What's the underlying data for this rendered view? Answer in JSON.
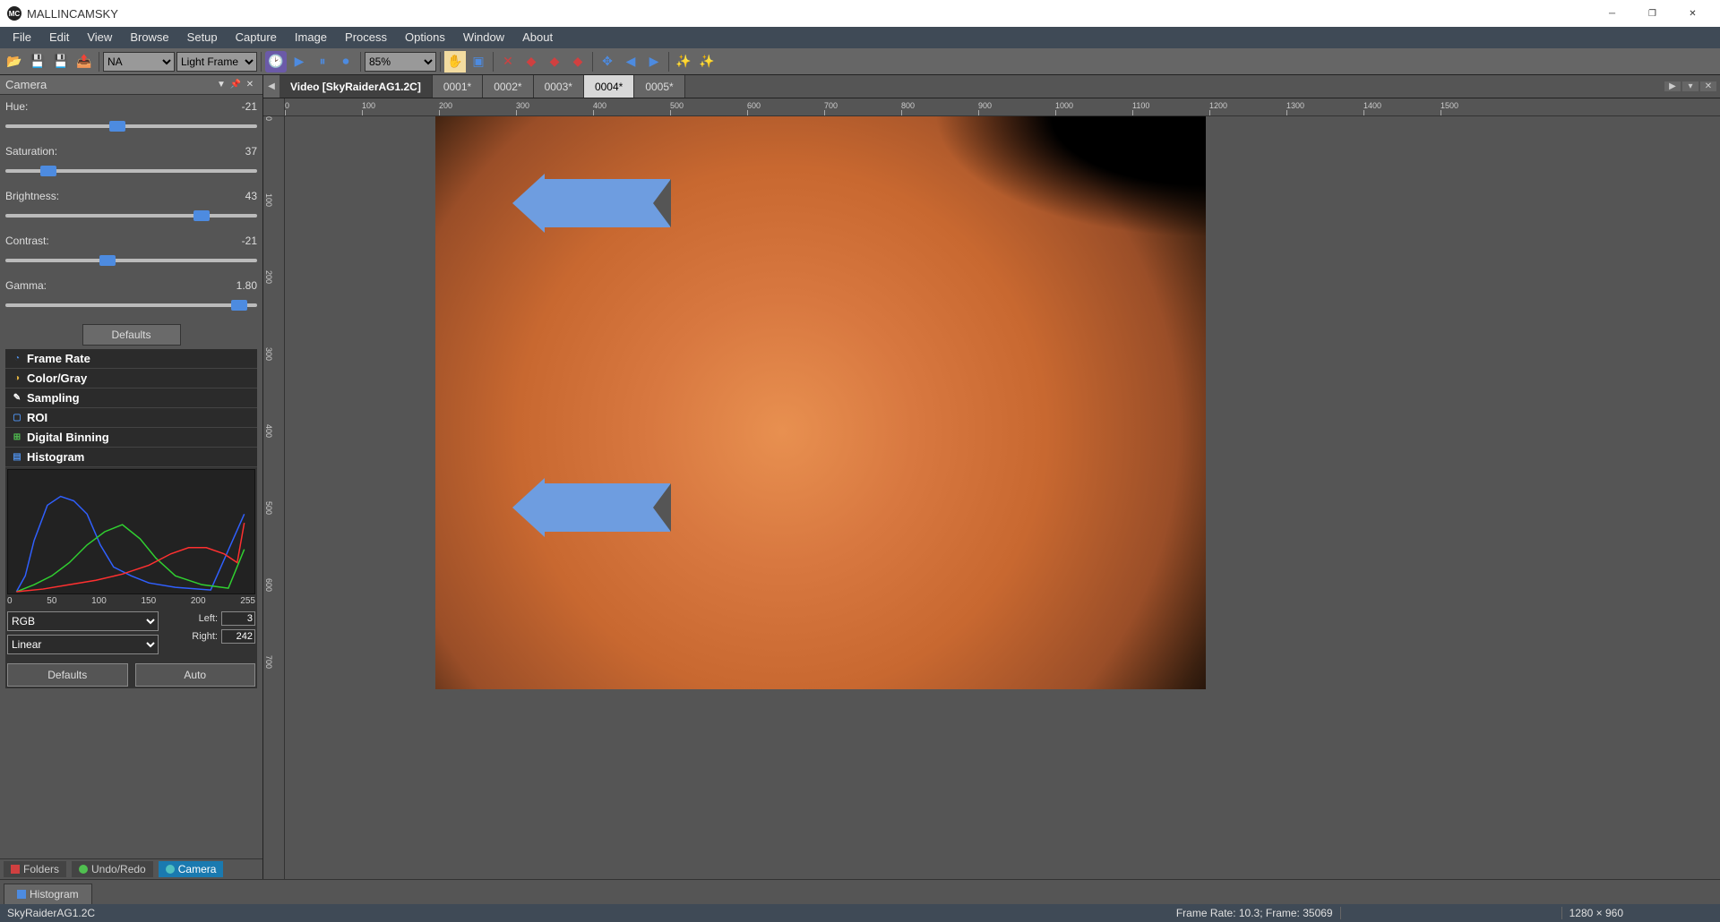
{
  "app": {
    "title": "MALLINCAMSKY"
  },
  "menu": {
    "items": [
      "File",
      "Edit",
      "View",
      "Browse",
      "Setup",
      "Capture",
      "Image",
      "Process",
      "Options",
      "Window",
      "About"
    ]
  },
  "toolbar": {
    "na_select": "NA",
    "frame_type": "Light Frame",
    "zoom": "85%"
  },
  "sidebar": {
    "title": "Camera",
    "sliders": {
      "hue": {
        "label": "Hue:",
        "value": "-21",
        "pos": 44
      },
      "saturation": {
        "label": "Saturation:",
        "value": "37",
        "pos": 15
      },
      "brightness": {
        "label": "Brightness:",
        "value": "43",
        "pos": 80
      },
      "contrast": {
        "label": "Contrast:",
        "value": "-21",
        "pos": 40
      },
      "gamma": {
        "label": "Gamma:",
        "value": "1.80",
        "pos": 96
      }
    },
    "defaults_btn": "Defaults",
    "sections": {
      "frame_rate": "Frame Rate",
      "color_gray": "Color/Gray",
      "sampling": "Sampling",
      "roi": "ROI",
      "digital_binning": "Digital Binning",
      "histogram": "Histogram"
    },
    "histogram": {
      "x_ticks": [
        "0",
        "50",
        "100",
        "150",
        "200",
        "255"
      ],
      "mode": "RGB",
      "scale": "Linear",
      "left_label": "Left:",
      "left_value": "3",
      "right_label": "Right:",
      "right_value": "242",
      "defaults_btn": "Defaults",
      "auto_btn": "Auto"
    },
    "bottom_tabs": {
      "folders": "Folders",
      "undo_redo": "Undo/Redo",
      "camera": "Camera"
    }
  },
  "tabs": {
    "video": "Video  [SkyRaiderAG1.2C]",
    "t1": "0001*",
    "t2": "0002*",
    "t3": "0003*",
    "t4": "0004*",
    "t5": "0005*"
  },
  "ruler": {
    "h_ticks": [
      "0",
      "100",
      "200",
      "300",
      "400",
      "500",
      "600",
      "700",
      "800",
      "900",
      "1000",
      "1100",
      "1200",
      "1300",
      "1400",
      "1500"
    ],
    "v_ticks": [
      "0",
      "100",
      "200",
      "300",
      "400",
      "500",
      "600",
      "700"
    ]
  },
  "bottom": {
    "histogram_tab": "Histogram"
  },
  "status": {
    "camera": "SkyRaiderAG1.2C",
    "frame_info": "Frame Rate: 10.3; Frame: 35069",
    "resolution": "1280 × 960"
  }
}
